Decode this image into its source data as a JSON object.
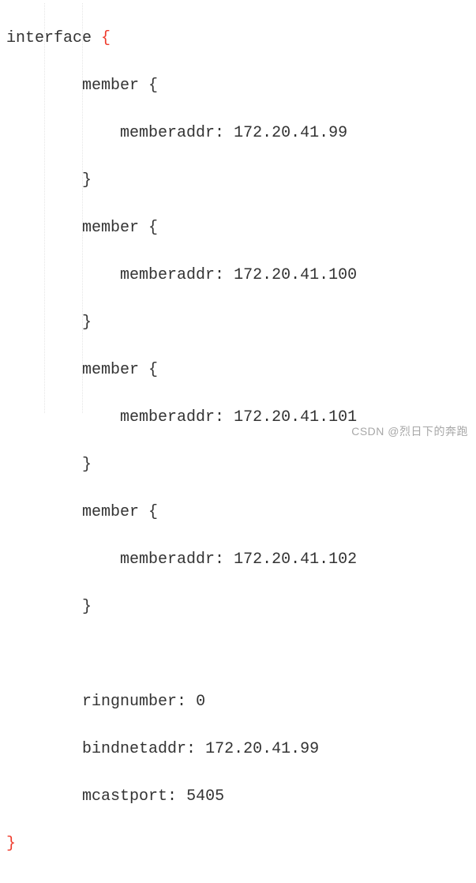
{
  "code": {
    "interface_keyword": "interface",
    "open_brace": "{",
    "close_brace": "}",
    "member_keyword": "member",
    "member_open": "{",
    "member_close": "}",
    "memberaddr_label": "memberaddr:",
    "members": [
      {
        "addr": "172.20.41.99"
      },
      {
        "addr": "172.20.41.100"
      },
      {
        "addr": "172.20.41.101"
      },
      {
        "addr": "172.20.41.102"
      }
    ],
    "ringnumber_label": "ringnumber:",
    "ringnumber_value": "0",
    "bindnetaddr_label": "bindnetaddr:",
    "bindnetaddr_value": "172.20.41.99",
    "mcastport_label": "mcastport:",
    "mcastport_value": "5405"
  },
  "watermark": "CSDN @烈日下的奔跑"
}
